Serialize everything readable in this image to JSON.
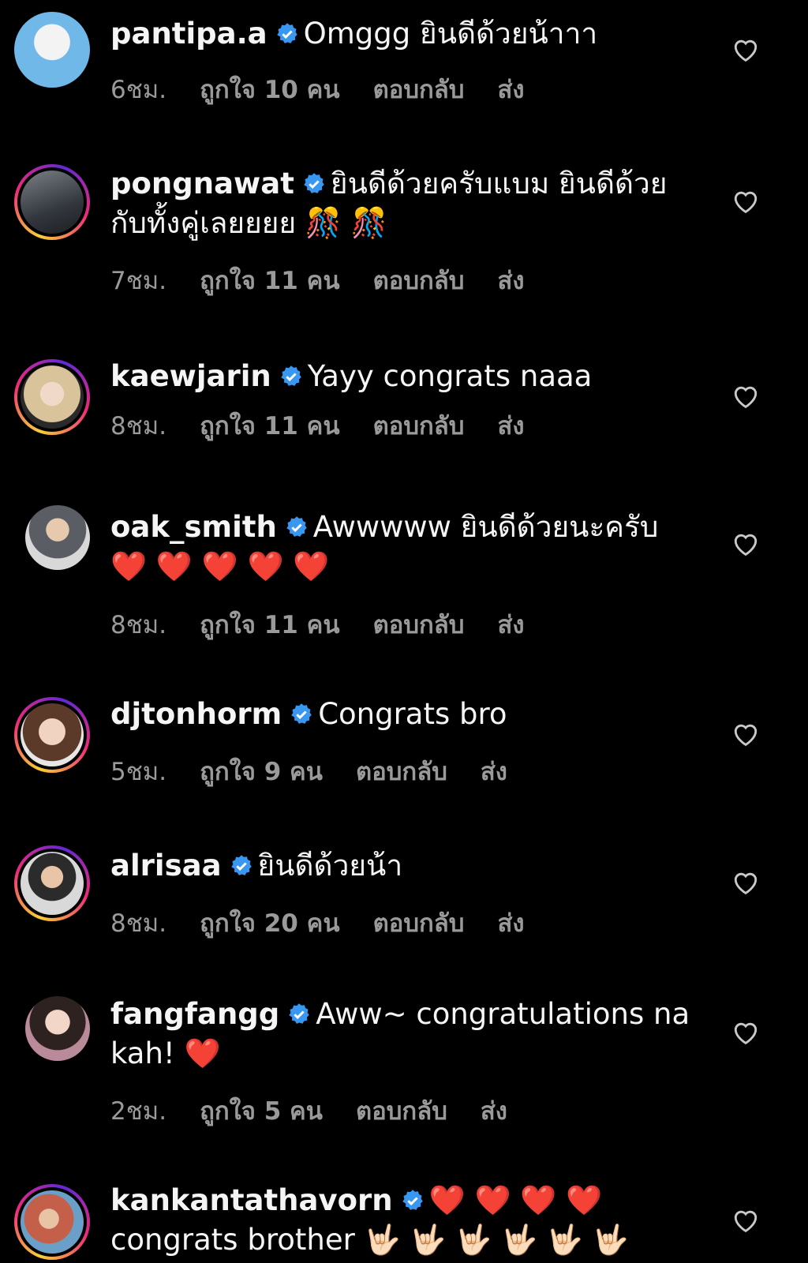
{
  "colors": {
    "background": "#000000",
    "text": "#f5f5f5",
    "meta": "#9a9a9a",
    "verified": "#3897f0"
  },
  "comments": [
    {
      "username": "pantipa.a",
      "text": "Omggg ยินดีด้วยน้าาา",
      "time": "6ชม.",
      "likes": "ถูกใจ 10 คน",
      "reply": "ตอบกลับ",
      "send": "ส่ง"
    },
    {
      "username": "pongnawat",
      "text": "ยินดีด้วยครับแบม ยินดีด้วยกับทั้งคู่เลยยยย 🎊 🎊",
      "time": "7ชม.",
      "likes": "ถูกใจ 11 คน",
      "reply": "ตอบกลับ",
      "send": "ส่ง"
    },
    {
      "username": "kaewjarin",
      "text": "Yayy congrats naaa",
      "time": "8ชม.",
      "likes": "ถูกใจ 11 คน",
      "reply": "ตอบกลับ",
      "send": "ส่ง"
    },
    {
      "username": "oak_smith",
      "text": "Awwwww ยินดีด้วยนะครับ ❤️ ❤️ ❤️ ❤️ ❤️",
      "time": "8ชม.",
      "likes": "ถูกใจ 11 คน",
      "reply": "ตอบกลับ",
      "send": "ส่ง"
    },
    {
      "username": "djtonhorm",
      "text": "Congrats bro",
      "time": "5ชม.",
      "likes": "ถูกใจ 9 คน",
      "reply": "ตอบกลับ",
      "send": "ส่ง"
    },
    {
      "username": "alrisaa",
      "text": "ยินดีด้วยน้า",
      "time": "8ชม.",
      "likes": "ถูกใจ 20 คน",
      "reply": "ตอบกลับ",
      "send": "ส่ง"
    },
    {
      "username": "fangfangg",
      "text": "Aww~ congratulations na kah! ❤️",
      "time": "2ชม.",
      "likes": "ถูกใจ 5 คน",
      "reply": "ตอบกลับ",
      "send": "ส่ง"
    },
    {
      "username": "kankantathavorn",
      "text": "❤️ ❤️ ❤️ ❤️ congrats brother 🤟🏻 🤟🏻 🤟🏻 🤟🏻 🤟🏻 🤟🏻",
      "time": "",
      "likes": "",
      "reply": "",
      "send": ""
    }
  ]
}
